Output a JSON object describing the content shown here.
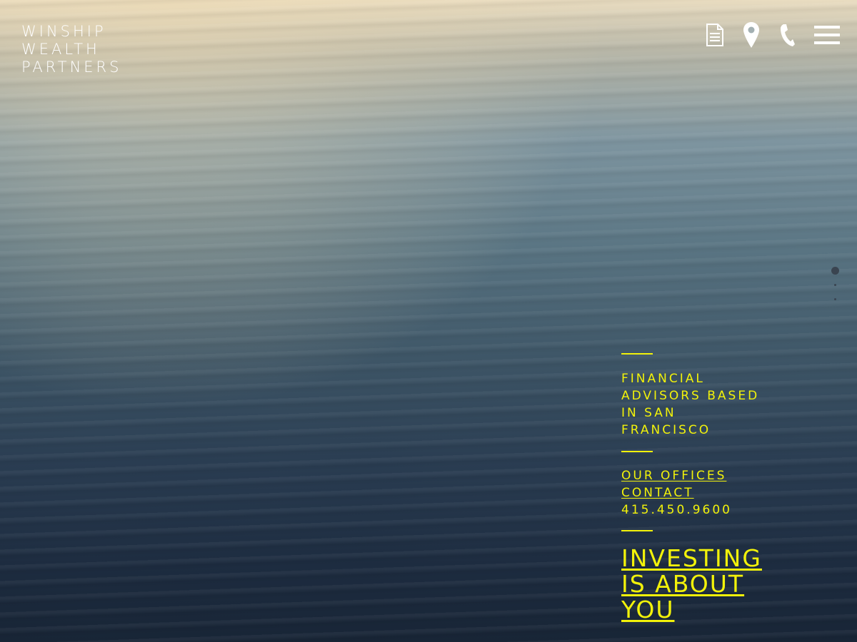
{
  "brand": {
    "line1": "WINSHIP",
    "line2": "WEALTH",
    "line3": "PARTNERS"
  },
  "nav": {
    "icons": [
      "document-icon",
      "location-pin-icon",
      "phone-icon",
      "hamburger-menu-icon"
    ],
    "icon_color": "#ffffff"
  },
  "panel": {
    "accent_color": "#f2f20a",
    "tagline": "FINANCIAL ADVISORS BASED IN SAN FRANCISCO",
    "offices_link": "OUR OFFICES",
    "contact_link": "CONTACT",
    "phone": "415.450.9600",
    "headline": "INVESTING IS ABOUT YOU"
  }
}
